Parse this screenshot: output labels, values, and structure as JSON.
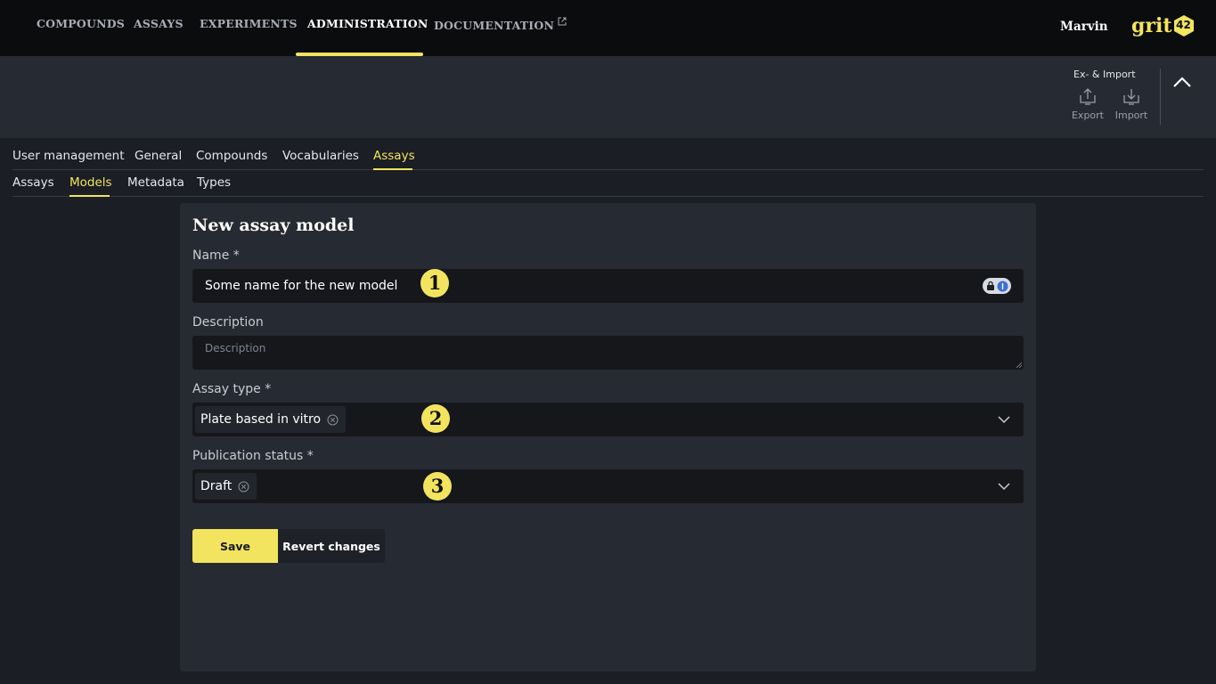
{
  "nav": {
    "items": [
      {
        "label": "COMPOUNDS"
      },
      {
        "label": "ASSAYS"
      },
      {
        "label": "EXPERIMENTS"
      },
      {
        "label": "ADMINISTRATION"
      },
      {
        "label": "DOCUMENTATION"
      }
    ],
    "active": "ADMINISTRATION",
    "user": "Marvin",
    "logo_text": "grit",
    "logo_badge": "42"
  },
  "toolbar": {
    "title": "Ex- & Import",
    "export_label": "Export",
    "import_label": "Import"
  },
  "admin_tabs": {
    "items": [
      "User management",
      "General",
      "Compounds",
      "Vocabularies",
      "Assays"
    ],
    "active": "Assays"
  },
  "assay_tabs": {
    "items": [
      "Assays",
      "Models",
      "Metadata",
      "Types"
    ],
    "active": "Models"
  },
  "form": {
    "title": "New assay model",
    "name_label": "Name *",
    "name_value": "Some name for the new model",
    "description_label": "Description",
    "description_placeholder": "Description",
    "assay_type_label": "Assay type *",
    "assay_type_value": "Plate based in vitro",
    "publication_status_label": "Publication status *",
    "publication_status_value": "Draft",
    "save_label": "Save",
    "revert_label": "Revert changes"
  },
  "callouts": [
    "1",
    "2",
    "3"
  ],
  "colors": {
    "accent": "#f2e45e",
    "nav_bg": "#0b0c0e",
    "page_bg": "#1b1e24",
    "panel_bg": "#262a32",
    "input_bg": "#15171b"
  }
}
